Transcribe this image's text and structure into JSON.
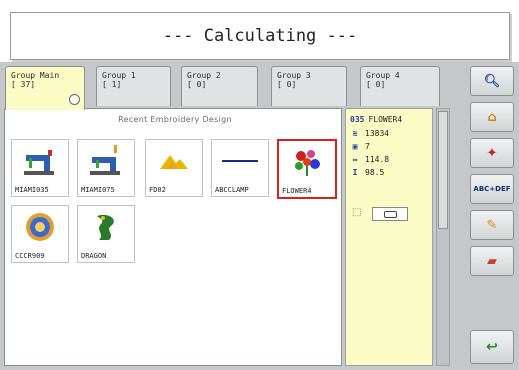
{
  "banner": {
    "text": "--- Calculating ---"
  },
  "tabs": [
    {
      "label": "Group Main",
      "count": "[ 37]",
      "active": true
    },
    {
      "label": "Group 1",
      "count": "[ 1]",
      "active": false
    },
    {
      "label": "Group 2",
      "count": "[ 0]",
      "active": false
    },
    {
      "label": "Group 3",
      "count": "[ 0]",
      "active": false
    },
    {
      "label": "Group 4",
      "count": "[ 0]",
      "active": false
    }
  ],
  "folder_path": "Recent Embroidery Design",
  "files": [
    {
      "name": "MIAMI035",
      "icon": "embroidery-machine-icon"
    },
    {
      "name": "MIAMI075",
      "icon": "embroidery-machine-icon"
    },
    {
      "name": "FD02",
      "icon": "mountain-design-icon"
    },
    {
      "name": "ABCCLAMP",
      "icon": "line-design-icon"
    },
    {
      "name": "FLOWER4",
      "icon": "flower-design-icon",
      "selected": true
    },
    {
      "name": "CCCR909",
      "icon": "badge-design-icon"
    },
    {
      "name": "DRAGON",
      "icon": "dragon-design-icon"
    }
  ],
  "info": {
    "index": "035",
    "name": "FLOWER4",
    "stitches": "13834",
    "colors": "7",
    "width": "114.8",
    "height": "98.5"
  },
  "side_buttons": [
    {
      "icon": "magnify-icon",
      "label": ""
    },
    {
      "icon": "hoop-icon",
      "label": ""
    },
    {
      "icon": "rotate-icon",
      "label": ""
    },
    {
      "icon": "",
      "label": "ABC+DEF"
    },
    {
      "icon": "color-icon",
      "label": ""
    },
    {
      "icon": "folder-icon",
      "label": ""
    },
    {
      "icon": "return-icon",
      "label": ""
    }
  ],
  "colors": {
    "panel_bg": "#c5c8c9",
    "tab_active": "#fbfbc6",
    "info_bg": "#fbfbc6",
    "selected_border": "#d92020"
  }
}
